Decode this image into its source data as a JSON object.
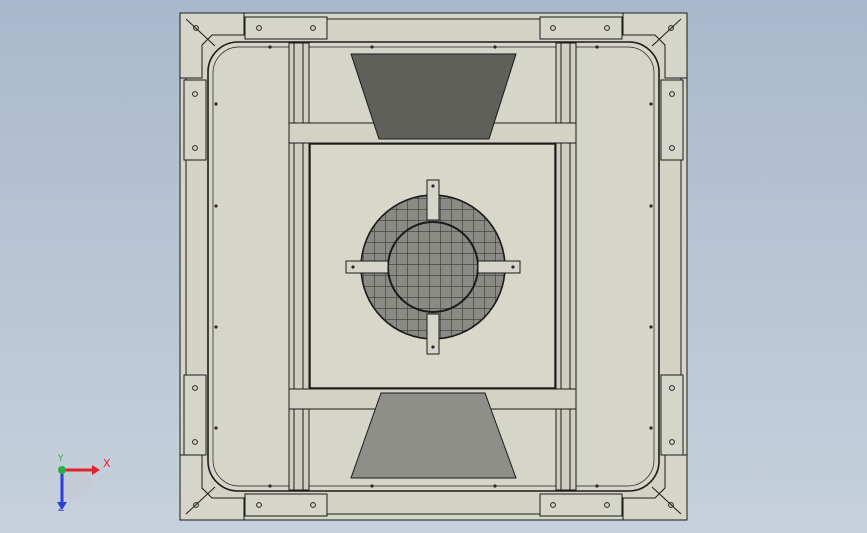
{
  "colors": {
    "background_top": "#a9b8cc",
    "background_bottom": "#c7d1dd",
    "panel_fill": "#d6d5c9",
    "panel_dark": "#c7c6b8",
    "edge": "#1b1b1b",
    "grille_dark": "#5f605a",
    "grille_light": "#8e8f88",
    "axis_x": "#e0242b",
    "axis_y": "#27b13b",
    "axis_z": "#2a3fd6"
  },
  "triad": {
    "x_label": "X",
    "y_label": "Y",
    "z_label": "Z"
  },
  "icons": {
    "triad": "coordinate-triad-icon",
    "fan": "fan-grille-icon"
  }
}
